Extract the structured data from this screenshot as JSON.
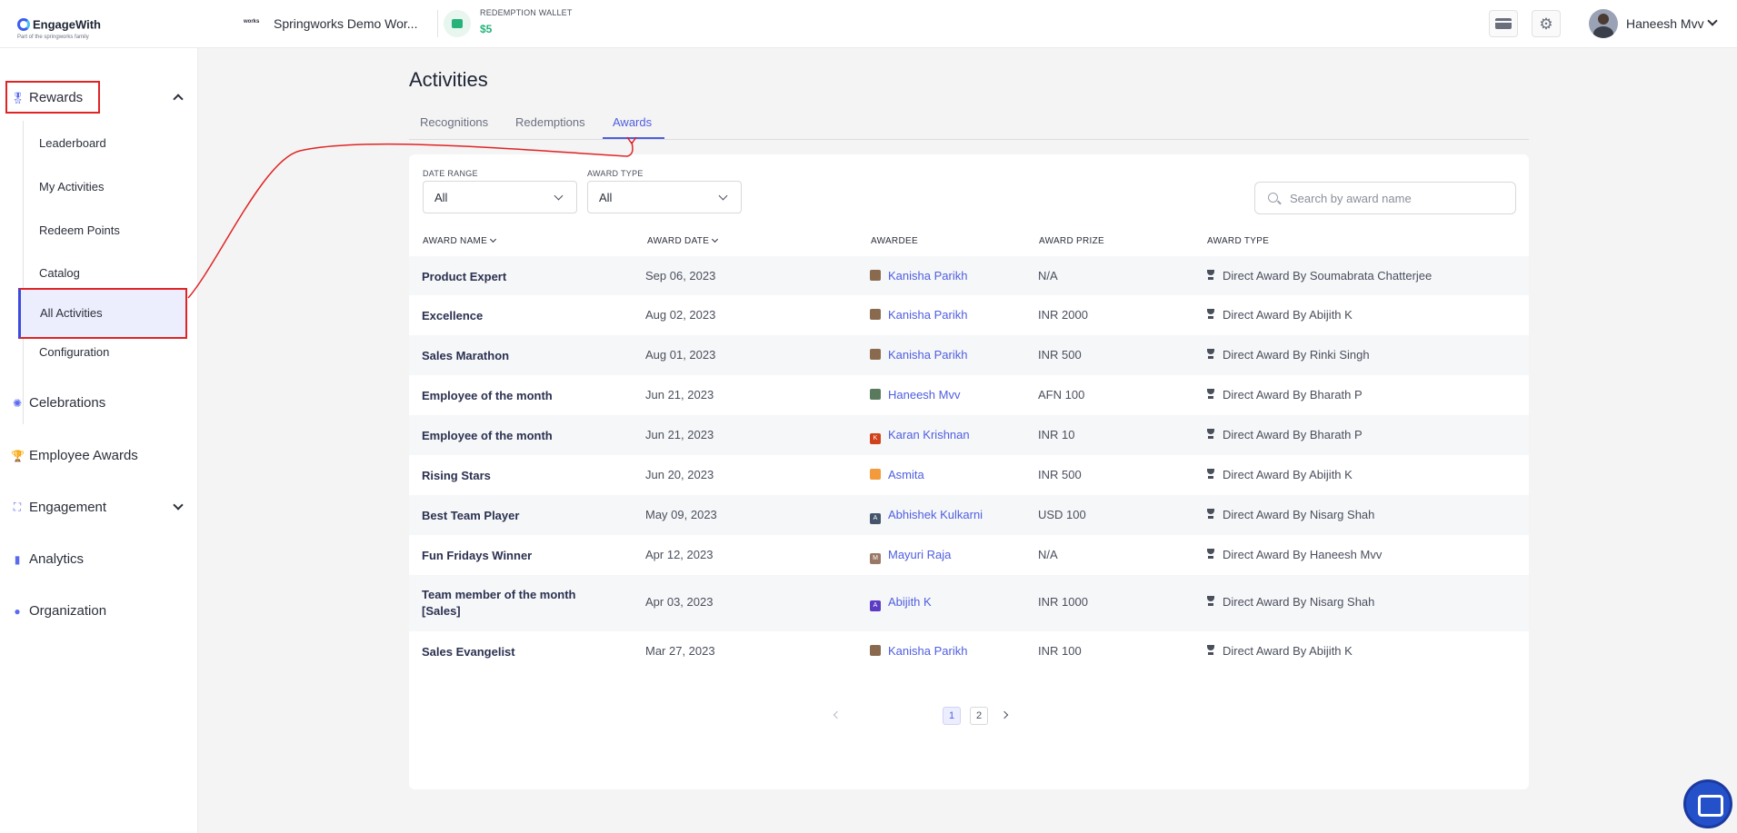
{
  "header": {
    "logo": "EngageWith",
    "logo_sub": "Part of the springworks family",
    "workspace_badge": "works",
    "workspace_name": "Springworks Demo Wor...",
    "wallet_label": "REDEMPTION WALLET",
    "wallet_value": "$5",
    "user_name": "Haneesh Mvv"
  },
  "sidebar": {
    "rewards": "Rewards",
    "sub_items": [
      "Leaderboard",
      "My Activities",
      "Redeem Points",
      "Catalog",
      "All Activities",
      "Configuration"
    ],
    "items": [
      "Celebrations",
      "Employee Awards",
      "Engagement",
      "Analytics",
      "Organization"
    ]
  },
  "main": {
    "title": "Activities",
    "tabs": [
      "Recognitions",
      "Redemptions",
      "Awards"
    ],
    "active_tab": "Awards",
    "filters": {
      "date_range_label": "DATE RANGE",
      "date_range_value": "All",
      "award_type_label": "AWARD TYPE",
      "award_type_value": "All"
    },
    "search_placeholder": "Search by award name",
    "columns": [
      "AWARD NAME",
      "AWARD DATE",
      "AWARDEE",
      "AWARD PRIZE",
      "AWARD TYPE"
    ],
    "rows": [
      {
        "name": "Product Expert",
        "date": "Sep 06, 2023",
        "awardee": "Kanisha Parikh",
        "prize": "N/A",
        "type": "Direct Award By Soumabrata Chatterjee"
      },
      {
        "name": "Excellence",
        "date": "Aug 02, 2023",
        "awardee": "Kanisha Parikh",
        "prize": "INR 2000",
        "type": "Direct Award By Abijith K"
      },
      {
        "name": "Sales Marathon",
        "date": "Aug 01, 2023",
        "awardee": "Kanisha Parikh",
        "prize": "INR 500",
        "type": "Direct Award By Rinki Singh"
      },
      {
        "name": "Employee of the month",
        "date": "Jun 21, 2023",
        "awardee": "Haneesh Mvv",
        "prize": "AFN 100",
        "type": "Direct Award By Bharath P"
      },
      {
        "name": "Employee of the month",
        "date": "Jun 21, 2023",
        "awardee": "Karan Krishnan",
        "prize": "INR 10",
        "type": "Direct Award By Bharath P"
      },
      {
        "name": "Rising Stars",
        "date": "Jun 20, 2023",
        "awardee": "Asmita",
        "prize": "INR 500",
        "type": "Direct Award By Abijith K"
      },
      {
        "name": "Best Team Player",
        "date": "May 09, 2023",
        "awardee": "Abhishek Kulkarni",
        "prize": "USD 100",
        "type": "Direct Award By Nisarg Shah"
      },
      {
        "name": "Fun Fridays Winner",
        "date": "Apr 12, 2023",
        "awardee": "Mayuri Raja",
        "prize": "N/A",
        "type": "Direct Award By Haneesh Mvv"
      },
      {
        "name": "Team member of the month [Sales]",
        "date": "Apr 03, 2023",
        "awardee": "Abijith K",
        "prize": "INR 1000",
        "type": "Direct Award By Nisarg Shah"
      },
      {
        "name": "Sales Evangelist",
        "date": "Mar 27, 2023",
        "awardee": "Kanisha Parikh",
        "prize": "INR 100",
        "type": "Direct Award By Abijith K"
      }
    ],
    "avatar_initials": [
      "",
      "",
      "",
      "",
      "K",
      "",
      "A",
      "M",
      "A",
      ""
    ],
    "avatar_colors": [
      "#8a6a4e",
      "#8a6a4e",
      "#8a6a4e",
      "#5a7a5e",
      "#d0421b",
      "#f39a3c",
      "#44556b",
      "#9a7866",
      "#5b3bc4",
      "#8a6a4e"
    ],
    "pages": [
      "1",
      "2"
    ],
    "current_page": "1"
  },
  "colors": {
    "accent": "#4f5ee0",
    "wallet": "#27b27a",
    "annotation": "#e02424"
  },
  "icons": [
    "card-icon",
    "gear-icon",
    "medal-icon",
    "confetti-icon",
    "trophy-icon",
    "engagement-icon",
    "analytics-icon",
    "organization-icon",
    "search-icon",
    "chat-icon"
  ]
}
